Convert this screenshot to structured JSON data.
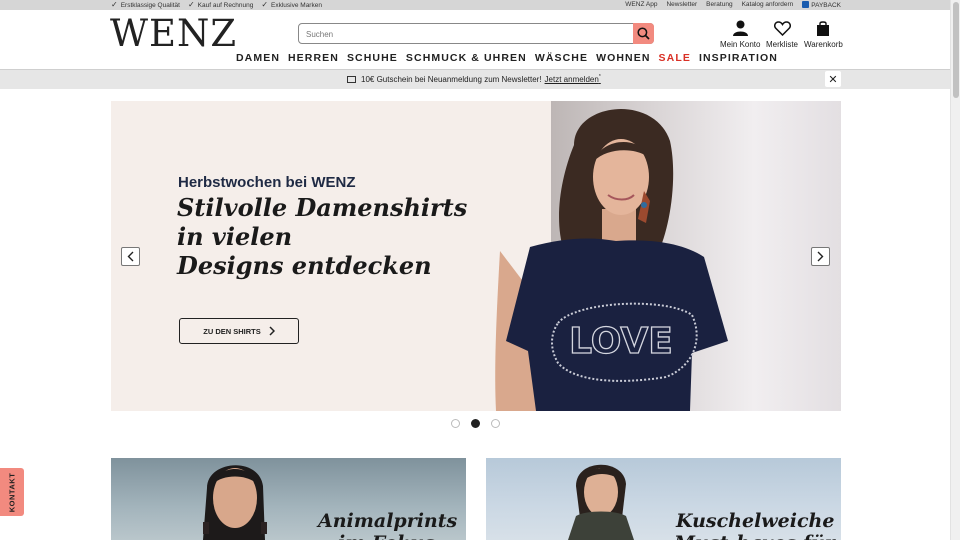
{
  "topbar": {
    "usps": [
      "Erstklassige Qualität",
      "Kauf auf Rechnung",
      "Exklusive Marken"
    ],
    "links": [
      "WENZ App",
      "Newsletter",
      "Beratung",
      "Katalog anfordern",
      "PAYBACK"
    ]
  },
  "header": {
    "logo": "WENZ",
    "search_placeholder": "Suchen",
    "actions": {
      "account": "Mein Konto",
      "wishlist": "Merkliste",
      "cart": "Warenkorb"
    }
  },
  "nav": [
    "DAMEN",
    "HERREN",
    "SCHUHE",
    "SCHMUCK & UHREN",
    "WÄSCHE",
    "WOHNEN",
    "SALE",
    "INSPIRATION"
  ],
  "promo": {
    "text": "10€ Gutschein bei Neuanmeldung zum Newsletter!",
    "link": "Jetzt anmelden",
    "sup": "*"
  },
  "hero": {
    "subtitle": "Herbstwochen bei WENZ",
    "headline": [
      "Stilvolle Damenshirts",
      "in vielen",
      "Designs entdecken"
    ],
    "cta": "ZU DEN SHIRTS",
    "shirt_print": "LOVE"
  },
  "carousel": {
    "slides": 3,
    "active_index": 1
  },
  "tiles": [
    {
      "title": "Animalprints",
      "subtitle": "im Fokus"
    },
    {
      "title": "Kuschelweiche",
      "subtitle": "Must-haves für"
    }
  ],
  "kontakt": "KONTAKT",
  "colors": {
    "accent_coral": "#f28a7f",
    "sale_red": "#d93025",
    "navy": "#1f2a44"
  }
}
